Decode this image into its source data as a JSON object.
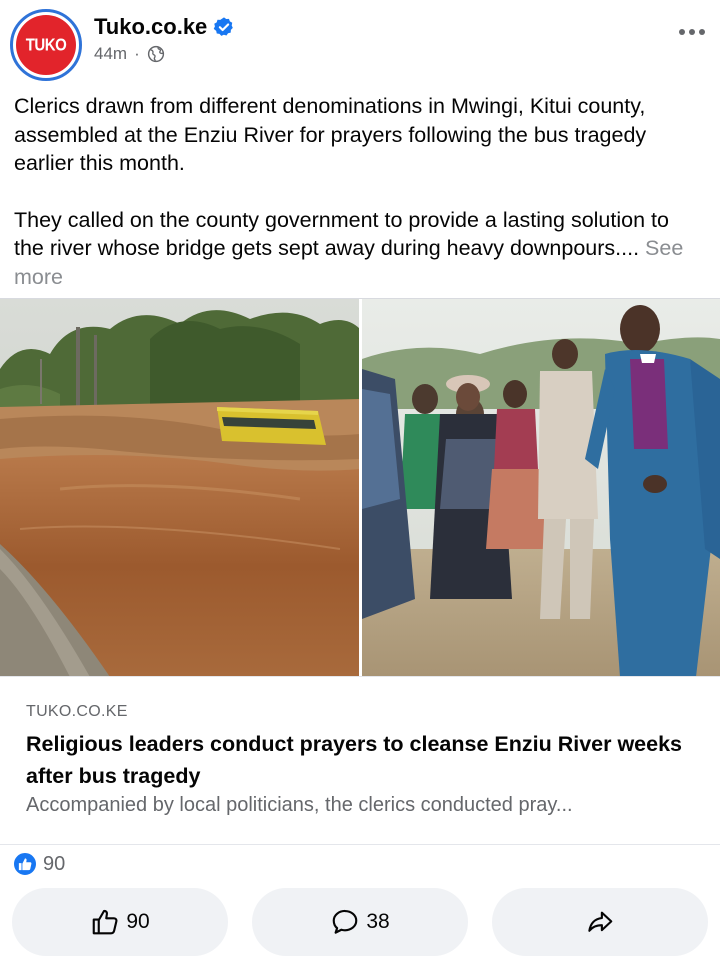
{
  "page": {
    "name": "Tuko.co.ke",
    "avatar_text": "TUKO",
    "time": "44m",
    "visibility_icon": "globe-icon",
    "verified_icon": "verified-badge-icon",
    "menu_icon": "more-options-icon"
  },
  "post": {
    "paragraph1": "Clerics drawn from different denominations in Mwingi, Kitui county, assembled at the Enziu River for prayers following the bus tragedy earlier this month.",
    "paragraph2": "They called on the county government to provide a lasting solution to the river whose bridge gets sept away during heavy downpours....",
    "see_more": "See more"
  },
  "link_preview": {
    "domain": "TUKO.CO.KE",
    "title": "Religious leaders conduct prayers to cleanse Enziu River weeks after bus tragedy",
    "description": "Accompanied by local politicians, the clerics conducted pray..."
  },
  "reactions": {
    "icon": "like-reaction-icon",
    "count": "90"
  },
  "actions": {
    "like_count": "90",
    "comment_count": "38",
    "like_icon": "thumbs-up-icon",
    "comment_icon": "comment-bubble-icon",
    "share_icon": "share-arrow-icon"
  },
  "colors": {
    "brand_red": "#e2242b",
    "facebook_blue": "#1877f2",
    "button_bg": "#f0f2f5",
    "secondary_text": "#65676b"
  }
}
